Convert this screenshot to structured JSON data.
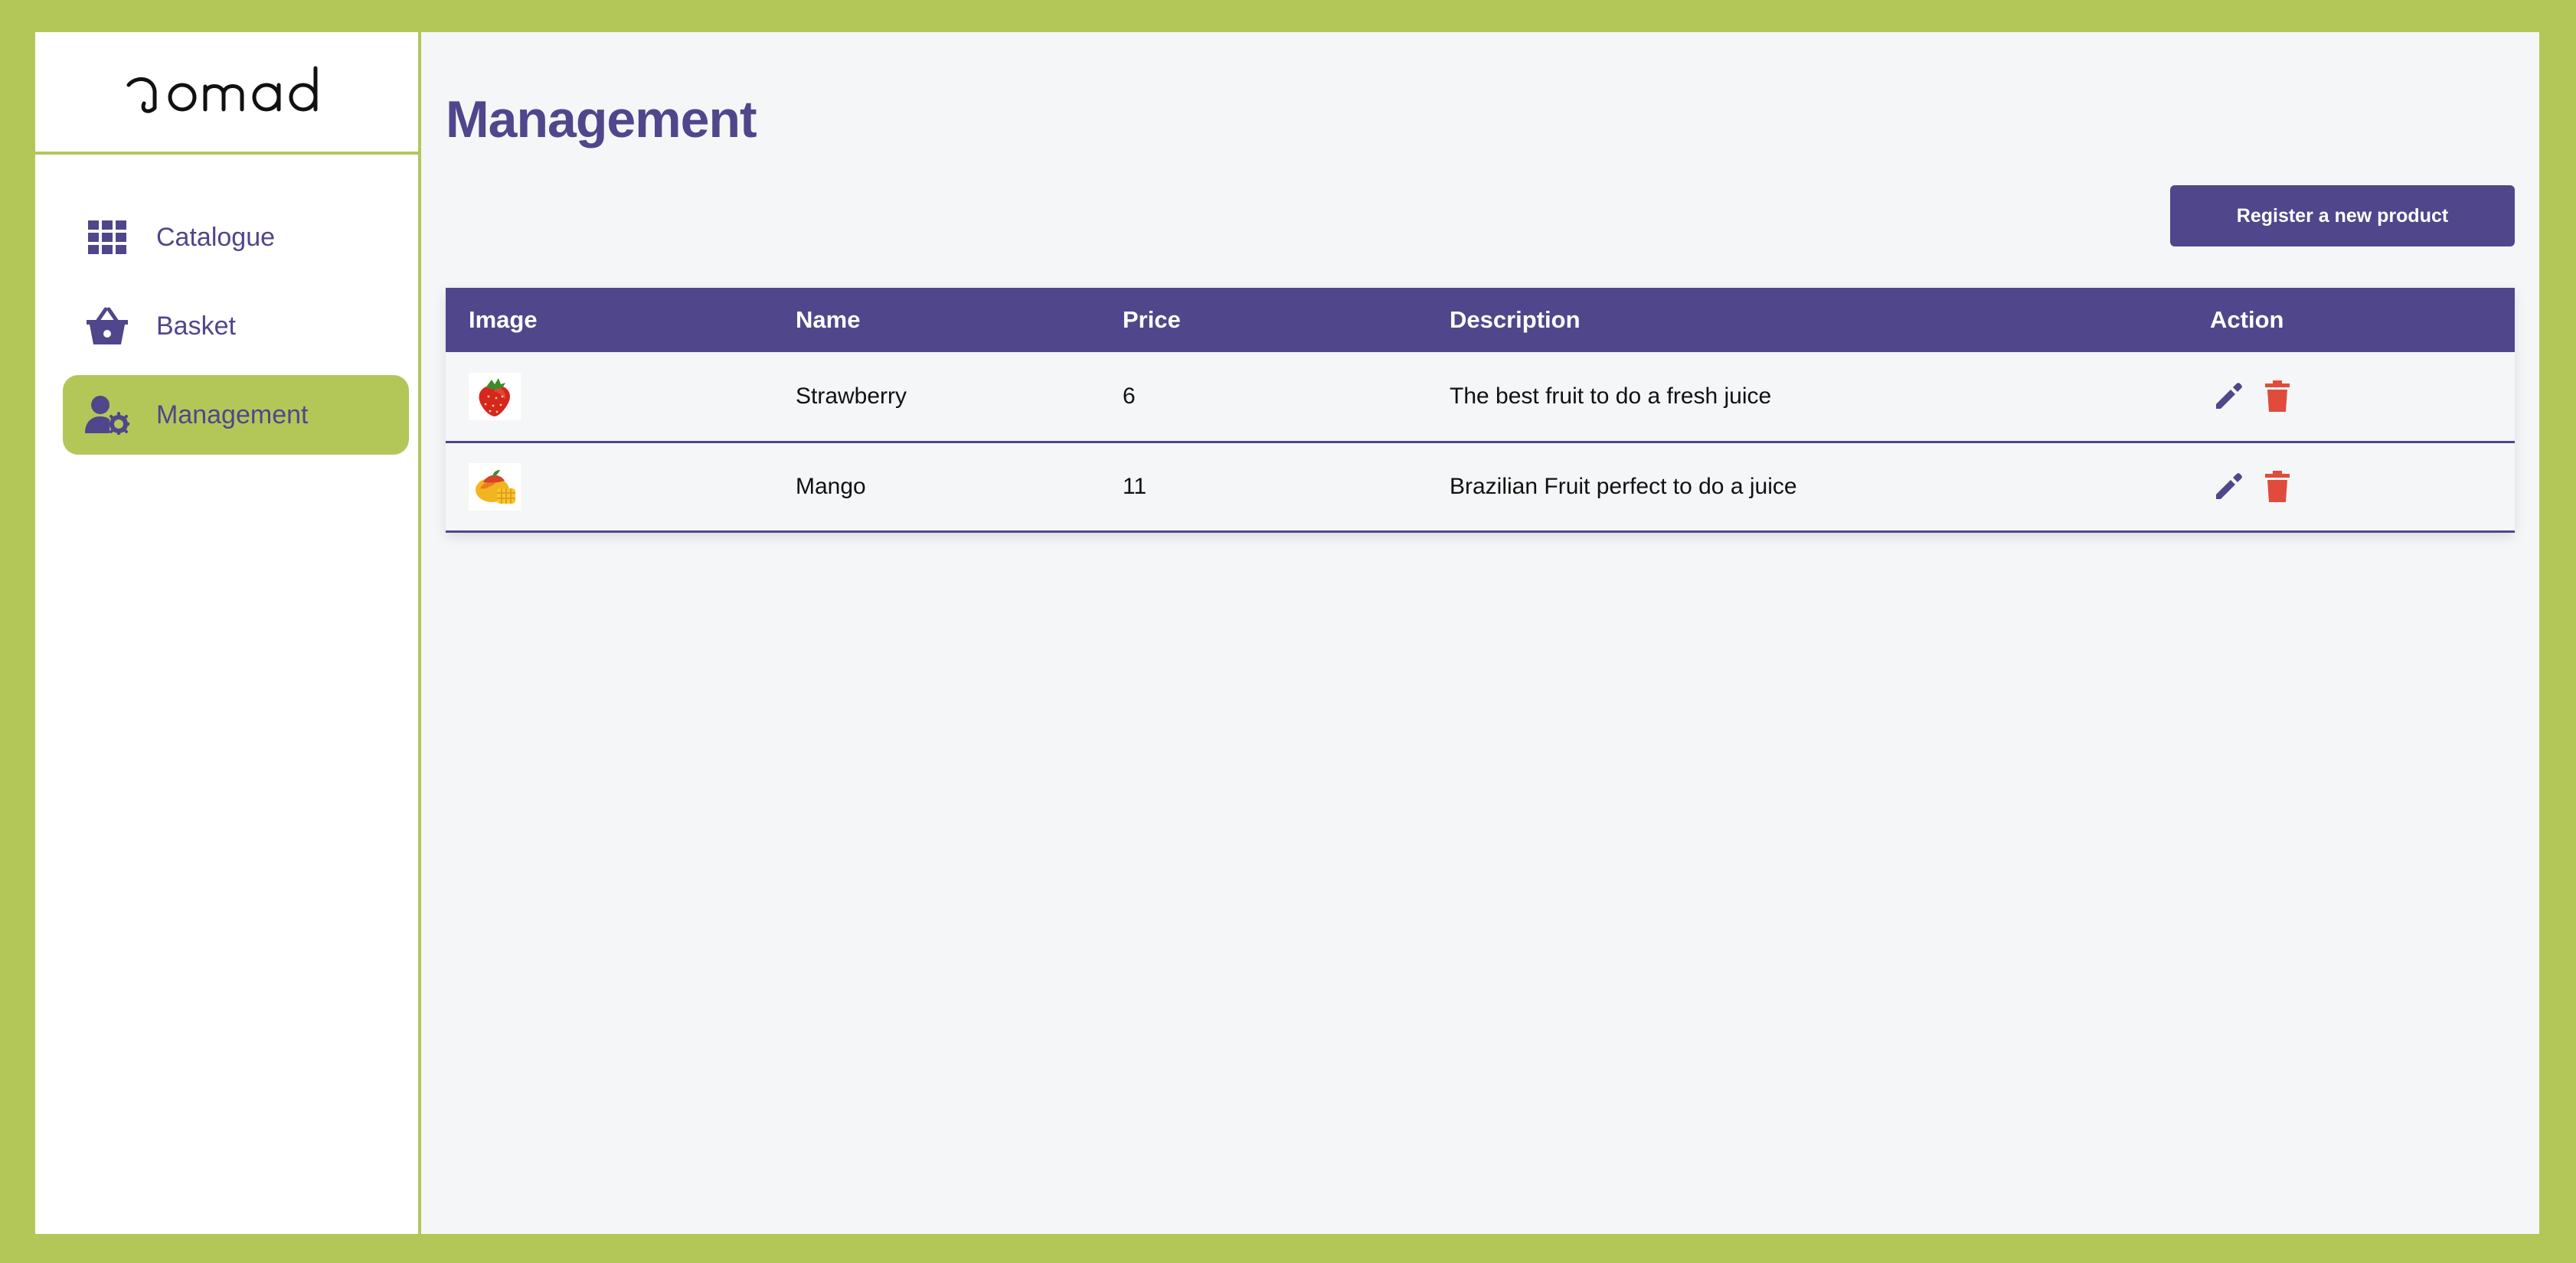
{
  "brand": {
    "logo_text": "nomad"
  },
  "sidebar": {
    "items": [
      {
        "label": "Catalogue",
        "icon": "grid-icon",
        "active": false
      },
      {
        "label": "Basket",
        "icon": "basket-icon",
        "active": false
      },
      {
        "label": "Management",
        "icon": "user-gear-icon",
        "active": true
      }
    ]
  },
  "main": {
    "title": "Management",
    "register_button": "Register a new product",
    "table": {
      "headers": [
        "Image",
        "Name",
        "Price",
        "Description",
        "Action"
      ],
      "rows": [
        {
          "image": "strawberry",
          "name": "Strawberry",
          "price": "6",
          "description": "The best fruit to do a fresh juice"
        },
        {
          "image": "mango",
          "name": "Mango",
          "price": "11",
          "description": "Brazilian Fruit perfect to do a juice"
        }
      ]
    }
  },
  "colors": {
    "accent_green": "#b3c759",
    "primary_purple": "#4f468b",
    "delete_red": "#e14b3c",
    "background": "#f5f6f8"
  }
}
